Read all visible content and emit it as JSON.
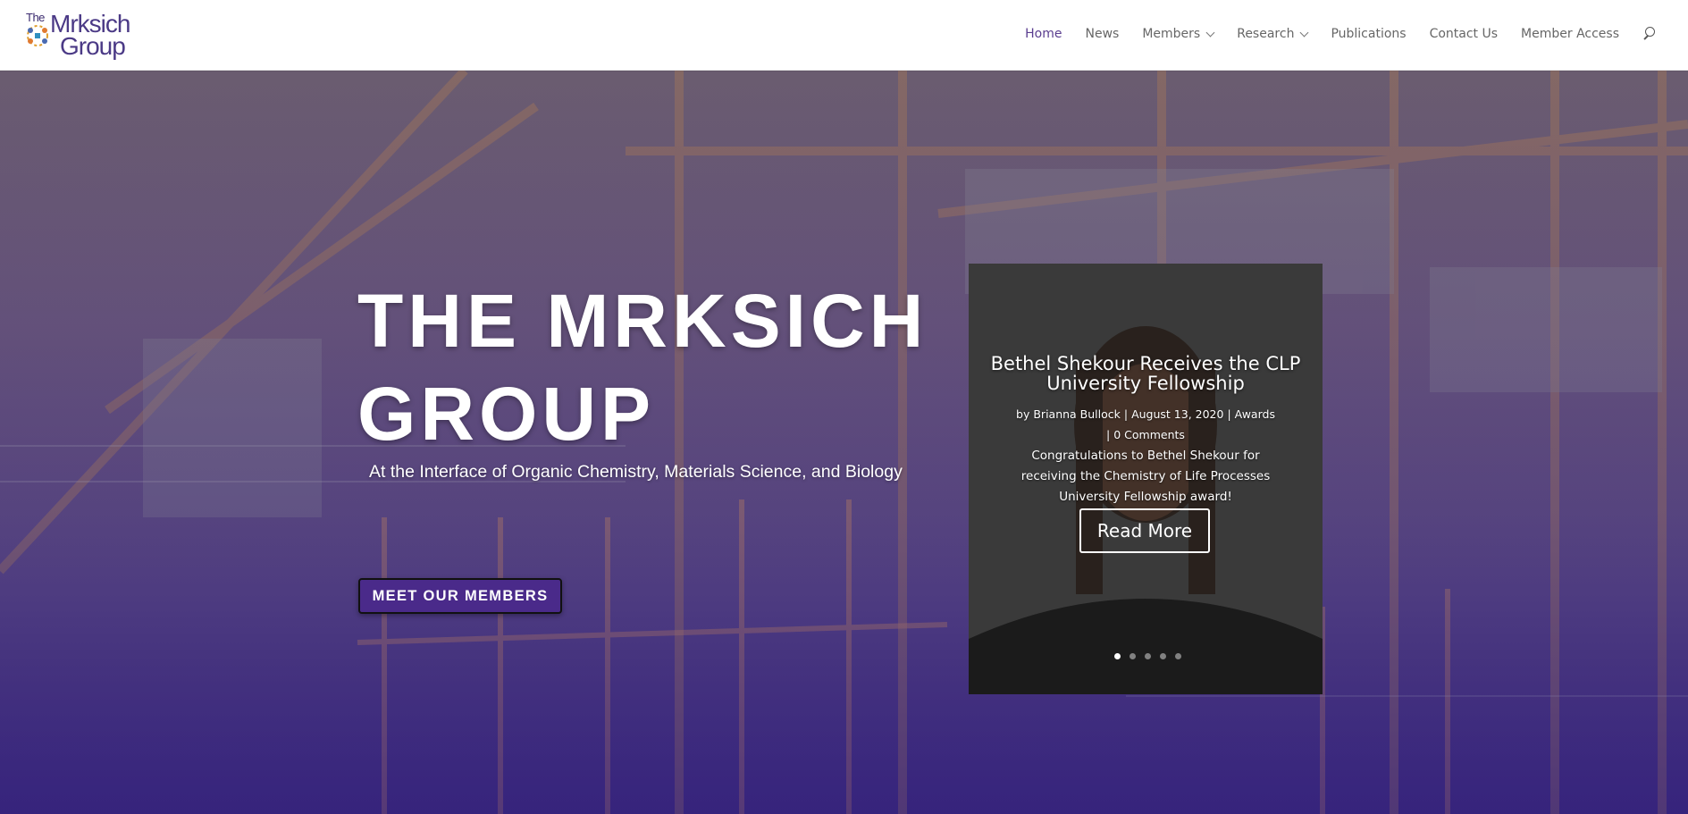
{
  "brand": {
    "logo_prefix": "The",
    "logo_name": "Mrksich",
    "logo_suffix": "Group"
  },
  "nav": {
    "items": [
      {
        "label": "Home",
        "active": true,
        "has_dropdown": false
      },
      {
        "label": "News",
        "active": false,
        "has_dropdown": false
      },
      {
        "label": "Members",
        "active": false,
        "has_dropdown": true
      },
      {
        "label": "Research",
        "active": false,
        "has_dropdown": true
      },
      {
        "label": "Publications",
        "active": false,
        "has_dropdown": false
      },
      {
        "label": "Contact Us",
        "active": false,
        "has_dropdown": false
      },
      {
        "label": "Member Access",
        "active": false,
        "has_dropdown": false
      }
    ],
    "search_icon": "search-icon",
    "active_color": "#5a3d8f"
  },
  "hero": {
    "title_line1": "THE MRKSICH",
    "title_line2": "GROUP",
    "subtitle": "At the Interface of Organic Chemistry, Materials Science, and Biology",
    "button_label": "MEET OUR MEMBERS",
    "button_color": "#4a2a8a"
  },
  "slider": {
    "title": "Bethel Shekour Receives the CLP University Fellowship",
    "meta_by": "by",
    "meta_author": "Brianna Bullock",
    "meta_sep": "|",
    "meta_date": "August 13, 2020",
    "meta_category": "Awards",
    "meta_comments": "0 Comments",
    "excerpt": "Congratulations to Bethel Shekour for receiving the Chemistry of Life Processes University Fellowship award!",
    "button_label": "Read More",
    "slide_count": 5,
    "active_slide": 1
  }
}
